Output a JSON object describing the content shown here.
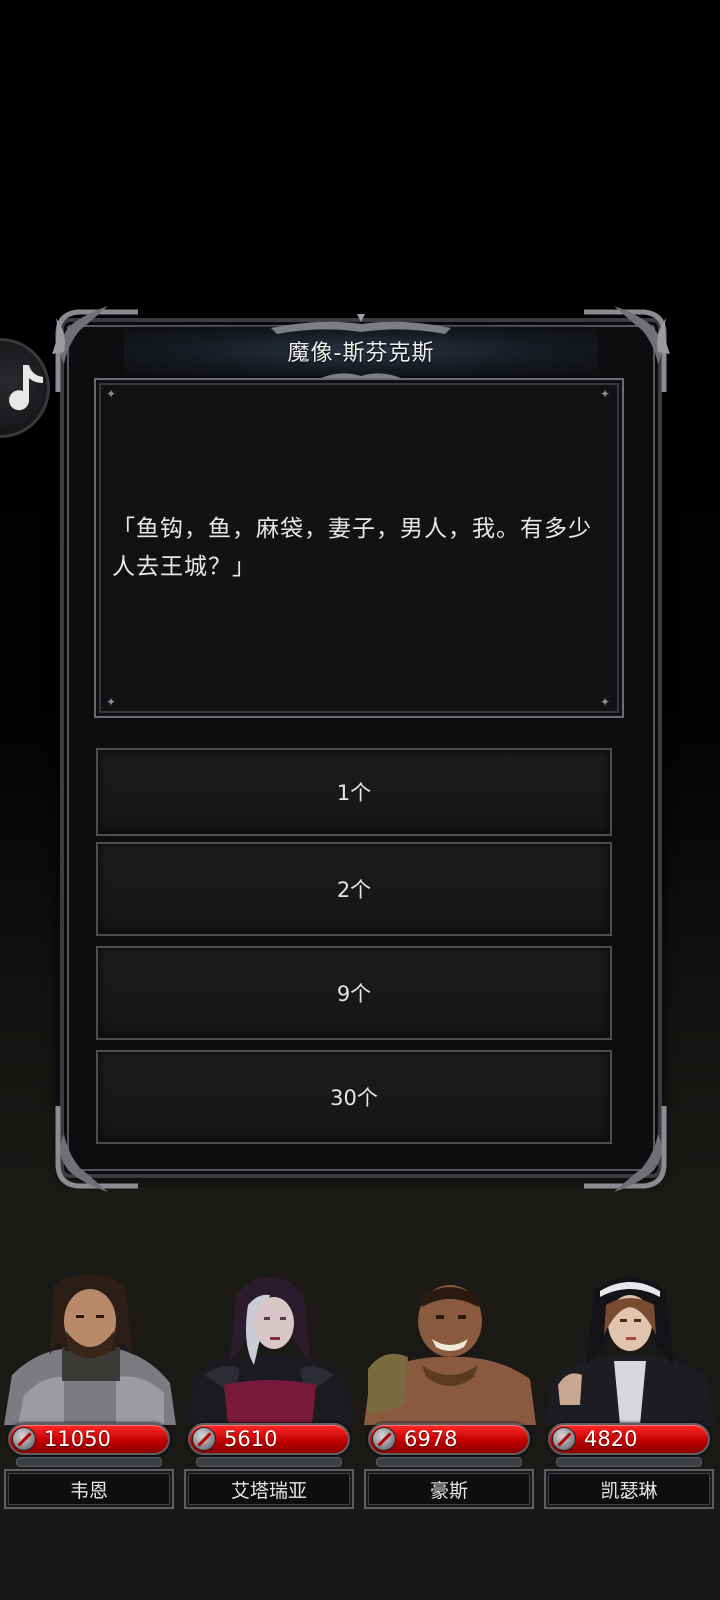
{
  "dialog": {
    "title": "魔像-斯芬克斯",
    "speech": "「鱼钩，鱼，麻袋，妻子，男人，我。有多少人去王城？」",
    "options": [
      {
        "label": "1个"
      },
      {
        "label": "2个"
      },
      {
        "label": "9个"
      },
      {
        "label": "30个"
      }
    ]
  },
  "party": [
    {
      "name": "韦恩",
      "hp": "11050"
    },
    {
      "name": "艾塔瑞亚",
      "hp": "5610"
    },
    {
      "name": "豪斯",
      "hp": "6978"
    },
    {
      "name": "凯瑟琳",
      "hp": "4820"
    }
  ],
  "colors": {
    "hp_red": "#d40000",
    "frame_grey": "#54565c",
    "background": "#000000"
  },
  "icons": {
    "side_button": "tiktok-note-icon",
    "hp": "sword-icon"
  }
}
